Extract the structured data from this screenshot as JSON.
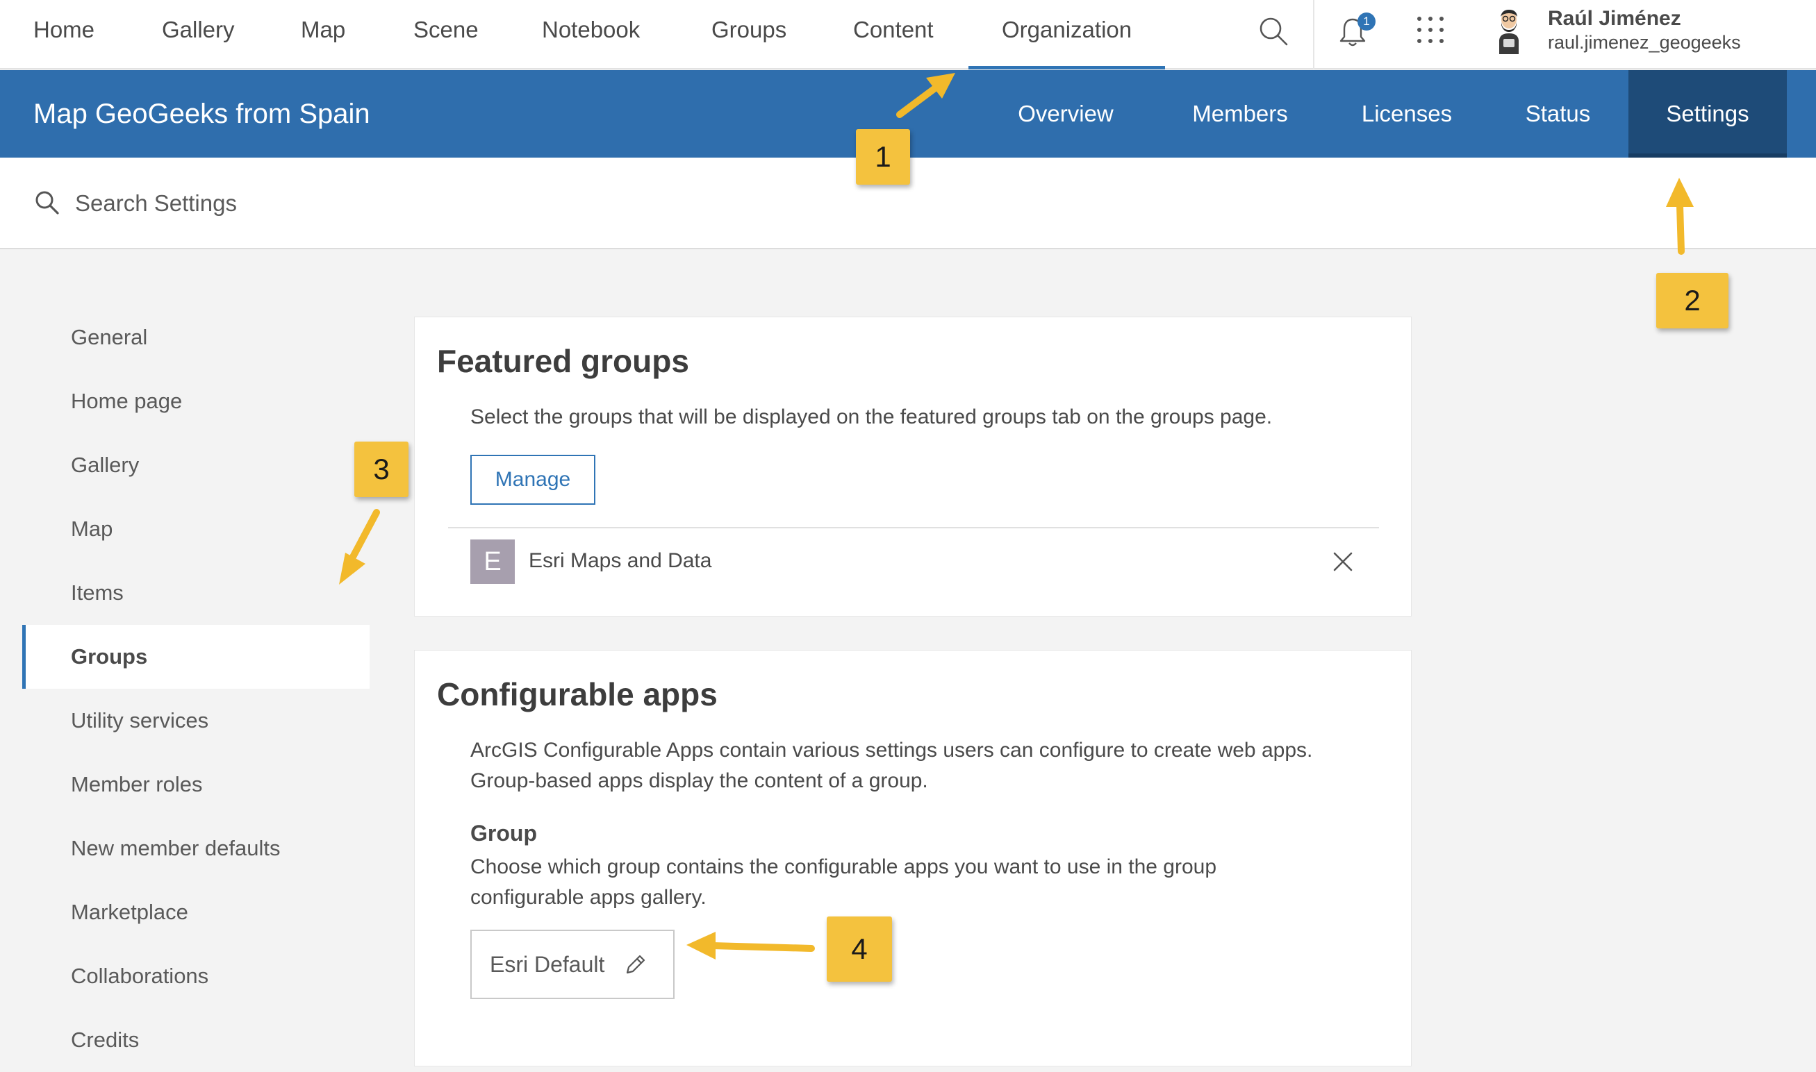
{
  "topnav": {
    "items": [
      "Home",
      "Gallery",
      "Map",
      "Scene",
      "Notebook",
      "Groups",
      "Content",
      "Organization"
    ],
    "active": "Organization",
    "notification_count": "1",
    "user_name": "Raúl Jiménez",
    "user_handle": "raul.jimenez_geogeeks",
    "icons": [
      "search-icon",
      "bell-icon",
      "app-launcher-icon",
      "avatar"
    ]
  },
  "org": {
    "title": "Map GeoGeeks from Spain",
    "tabs": [
      "Overview",
      "Members",
      "Licenses",
      "Status",
      "Settings"
    ],
    "active_tab": "Settings"
  },
  "search": {
    "placeholder": "Search Settings"
  },
  "sidenav": {
    "items": [
      "General",
      "Home page",
      "Gallery",
      "Map",
      "Items",
      "Groups",
      "Utility services",
      "Member roles",
      "New member defaults",
      "Marketplace",
      "Collaborations",
      "Credits"
    ],
    "active": "Groups"
  },
  "featured_groups": {
    "title": "Featured groups",
    "description": "Select the groups that will be displayed on the featured groups tab on the groups page.",
    "manage_label": "Manage",
    "groups": [
      {
        "initial": "E",
        "name": "Esri Maps and Data"
      }
    ]
  },
  "configurable_apps": {
    "title": "Configurable apps",
    "description_line1": "ArcGIS Configurable Apps contain various settings users can configure to create web apps.",
    "description_line2": "Group-based apps display the content of a group.",
    "group_label": "Group",
    "group_description_line1": "Choose which group contains the configurable apps you want to use in the group",
    "group_description_line2": "configurable apps gallery.",
    "group_value": "Esri Default"
  },
  "callouts": [
    "1",
    "2",
    "3",
    "4"
  ],
  "colors": {
    "accent": "#2f74b5",
    "header": "#2f6ead",
    "header_active": "#1e4b78",
    "callout": "#f4c23e"
  }
}
